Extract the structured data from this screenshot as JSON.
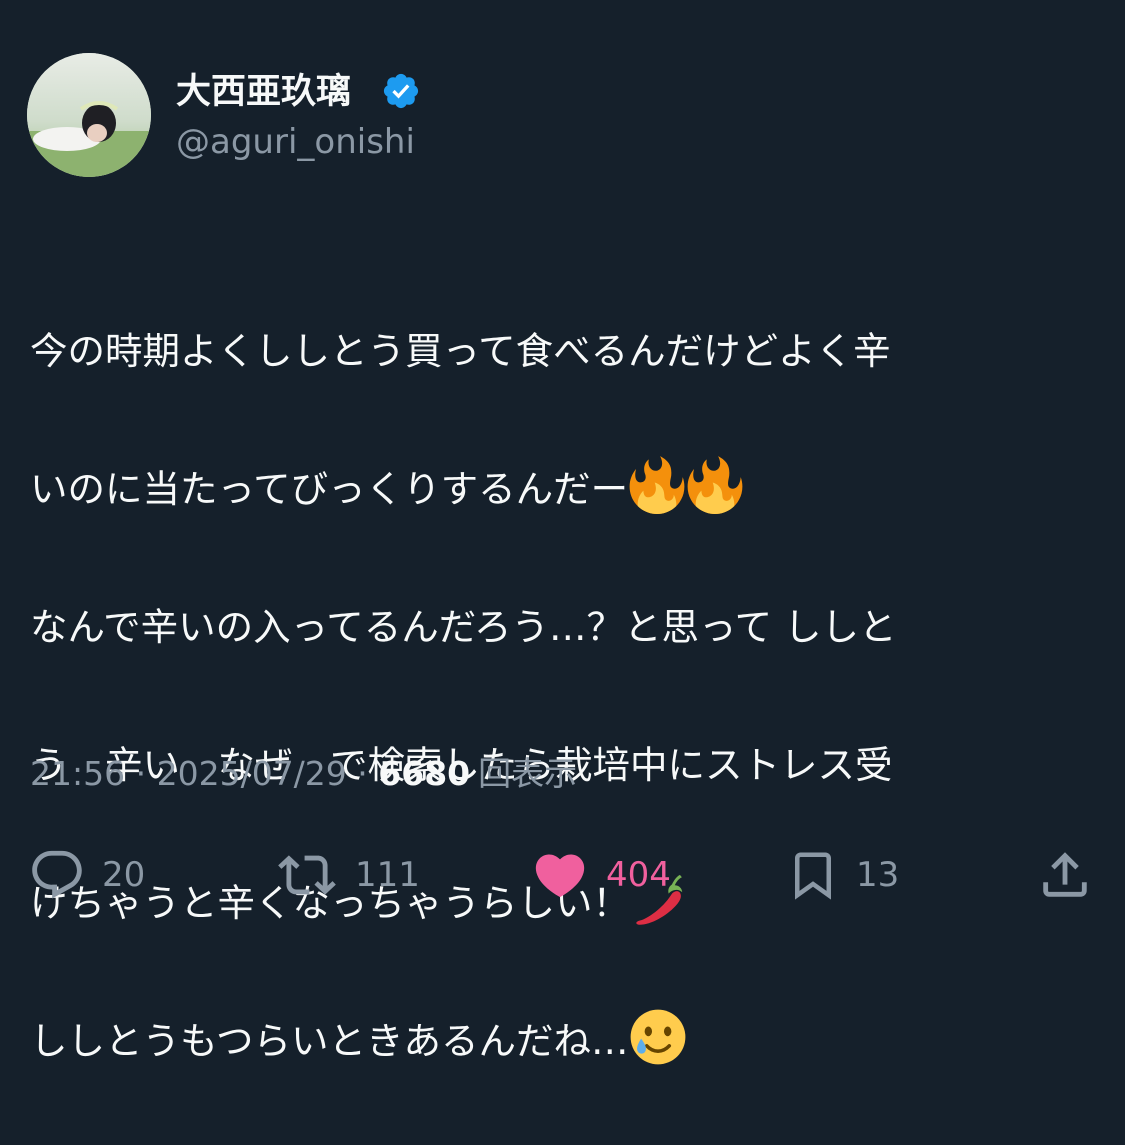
{
  "author": {
    "display_name": "大西亜玖璃",
    "handle": "@aguri_onishi",
    "verified": true,
    "avatar_icon": "profile-photo"
  },
  "tweet": {
    "lines": [
      "今の時期よくししとう買って食べるんだけどよく辛",
      "いのに当たってびっくりするんだー",
      "なんで辛いの入ってるんだろう…？と思って ししと",
      "う　辛い　なぜ　で検索したら栽培中にストレス受",
      "けちゃうと辛くなっちゃうらしい！",
      "ししとうもつらいときあるんだね…"
    ],
    "emojis": [
      "fire-emoji",
      "fire-emoji",
      "chili-pepper-emoji",
      "smiling-face-with-tear-emoji"
    ]
  },
  "meta": {
    "time": "21:56",
    "separator": " · ",
    "date": "2025/07/29",
    "views_count": "6680",
    "views_label": "回表示"
  },
  "actions": {
    "replies": "20",
    "retweets": "111",
    "likes": "404",
    "bookmarks": "13"
  },
  "colors": {
    "background": "#15202b",
    "text": "#f7f9f9",
    "secondary": "#8b98a5",
    "like": "#f0609e",
    "verified": "#1d9bf0"
  }
}
